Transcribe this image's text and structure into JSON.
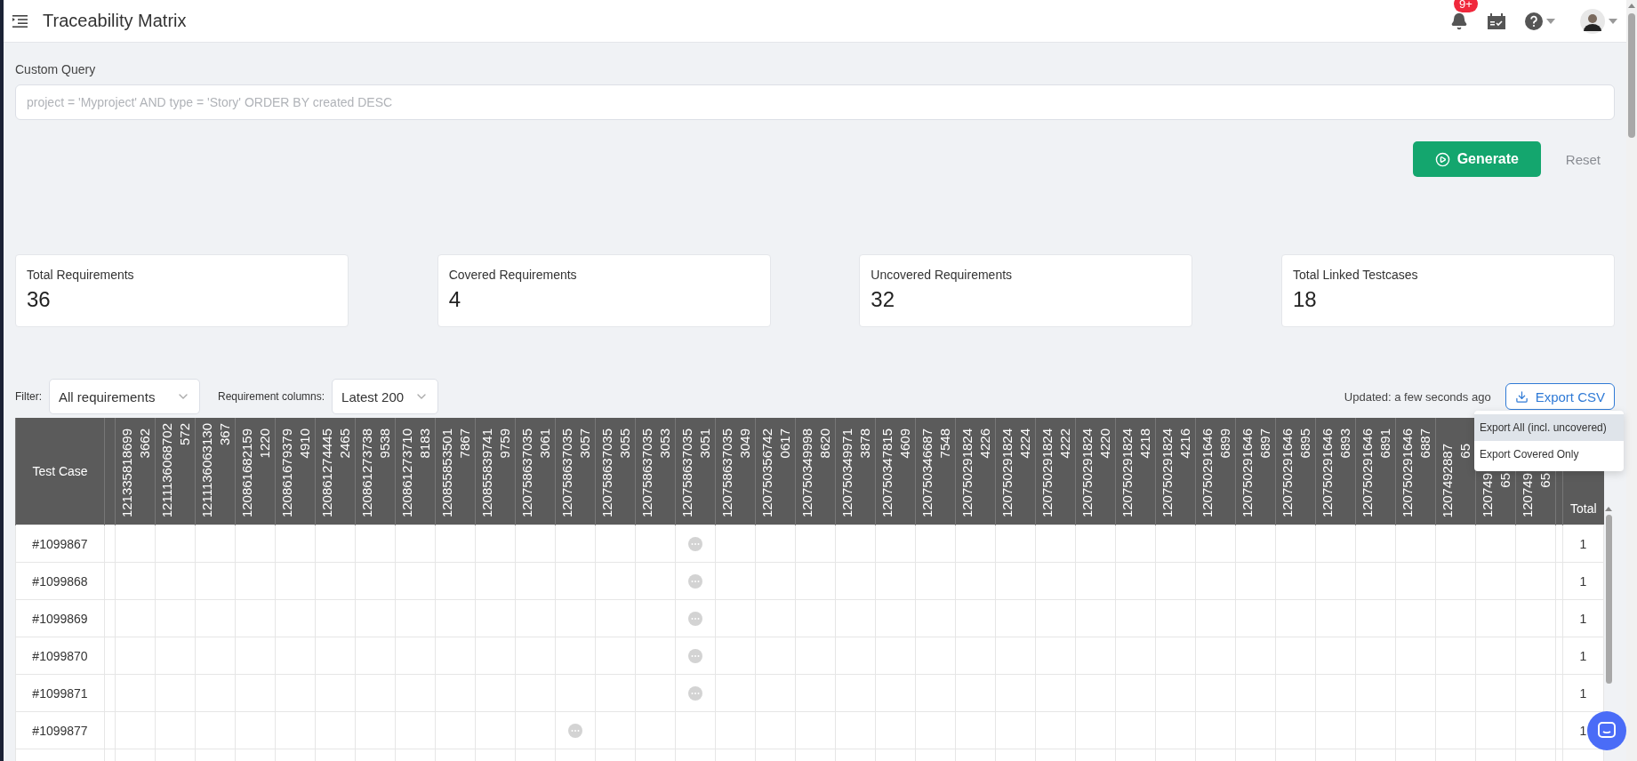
{
  "header": {
    "title": "Traceability Matrix",
    "notification_badge": "9+"
  },
  "query": {
    "label": "Custom Query",
    "placeholder": "project = 'Myproject' AND type = 'Story' ORDER BY created DESC"
  },
  "actions": {
    "generate": "Generate",
    "reset": "Reset"
  },
  "stats": [
    {
      "label": "Total Requirements",
      "value": "36"
    },
    {
      "label": "Covered Requirements",
      "value": "4"
    },
    {
      "label": "Uncovered Requirements",
      "value": "32"
    },
    {
      "label": "Total Linked Testcases",
      "value": "18"
    }
  ],
  "filters": [
    {
      "label": "Filter:",
      "value": "All requirements"
    },
    {
      "label": "Requirement columns:",
      "value": "Latest 200"
    }
  ],
  "updated": "Updated: a few seconds ago",
  "export": {
    "label": "Export CSV",
    "menu": [
      {
        "label": "Export All (incl. uncovered)",
        "highlighted": true
      },
      {
        "label": "Export Covered Only",
        "highlighted": false
      }
    ]
  },
  "table": {
    "first_column": "Test Case",
    "last_column": "Total",
    "columns": [
      [
        "121335818699",
        "3662"
      ],
      [
        "1211136068702",
        "572"
      ],
      [
        "1211136063130",
        "367"
      ],
      [
        "120861682159",
        "1220"
      ],
      [
        "120861679379",
        "4910"
      ],
      [
        "120861274445",
        "2465"
      ],
      [
        "120861273738",
        "9538"
      ],
      [
        "120861273710",
        "8183"
      ],
      [
        "120855853501",
        "7867"
      ],
      [
        "120855839741",
        "9759"
      ],
      [
        "120758637035",
        "3061"
      ],
      [
        "120758637035",
        "3057"
      ],
      [
        "120758637035",
        "3055"
      ],
      [
        "120758637035",
        "3053"
      ],
      [
        "120758637035",
        "3051"
      ],
      [
        "120758637035",
        "3049"
      ],
      [
        "120750356742",
        "0617"
      ],
      [
        "120750349998",
        "8620"
      ],
      [
        "120750349971",
        "3878"
      ],
      [
        "120750347815",
        "4609"
      ],
      [
        "120750346687",
        "7548"
      ],
      [
        "120750291824",
        "4226"
      ],
      [
        "120750291824",
        "4224"
      ],
      [
        "120750291824",
        "4222"
      ],
      [
        "120750291824",
        "4220"
      ],
      [
        "120750291824",
        "4218"
      ],
      [
        "120750291824",
        "4216"
      ],
      [
        "120750291646",
        "6899"
      ],
      [
        "120750291646",
        "6897"
      ],
      [
        "120750291646",
        "6895"
      ],
      [
        "120750291646",
        "6893"
      ],
      [
        "120750291646",
        "6891"
      ],
      [
        "120750291646",
        "6887"
      ],
      [
        "1207492887",
        "65"
      ],
      [
        "120749",
        "65"
      ],
      [
        "120749",
        "65"
      ]
    ],
    "rows": [
      {
        "test_case": "#1099867",
        "total": "1",
        "links": [
          false,
          false,
          false,
          false,
          false,
          false,
          false,
          false,
          false,
          false,
          false,
          false,
          false,
          false,
          true,
          false,
          false,
          false,
          false,
          false,
          false,
          false,
          false,
          false,
          false,
          false,
          false,
          false,
          false,
          false,
          false,
          false,
          false,
          false,
          false,
          false
        ]
      },
      {
        "test_case": "#1099868",
        "total": "1",
        "links": [
          false,
          false,
          false,
          false,
          false,
          false,
          false,
          false,
          false,
          false,
          false,
          false,
          false,
          false,
          true,
          false,
          false,
          false,
          false,
          false,
          false,
          false,
          false,
          false,
          false,
          false,
          false,
          false,
          false,
          false,
          false,
          false,
          false,
          false,
          false,
          false
        ]
      },
      {
        "test_case": "#1099869",
        "total": "1",
        "links": [
          false,
          false,
          false,
          false,
          false,
          false,
          false,
          false,
          false,
          false,
          false,
          false,
          false,
          false,
          true,
          false,
          false,
          false,
          false,
          false,
          false,
          false,
          false,
          false,
          false,
          false,
          false,
          false,
          false,
          false,
          false,
          false,
          false,
          false,
          false,
          false
        ]
      },
      {
        "test_case": "#1099870",
        "total": "1",
        "links": [
          false,
          false,
          false,
          false,
          false,
          false,
          false,
          false,
          false,
          false,
          false,
          false,
          false,
          false,
          true,
          false,
          false,
          false,
          false,
          false,
          false,
          false,
          false,
          false,
          false,
          false,
          false,
          false,
          false,
          false,
          false,
          false,
          false,
          false,
          false,
          false
        ]
      },
      {
        "test_case": "#1099871",
        "total": "1",
        "links": [
          false,
          false,
          false,
          false,
          false,
          false,
          false,
          false,
          false,
          false,
          false,
          false,
          false,
          false,
          true,
          false,
          false,
          false,
          false,
          false,
          false,
          false,
          false,
          false,
          false,
          false,
          false,
          false,
          false,
          false,
          false,
          false,
          false,
          false,
          false,
          false
        ]
      },
      {
        "test_case": "#1099877",
        "total": "1",
        "links": [
          false,
          false,
          false,
          false,
          false,
          false,
          false,
          false,
          false,
          false,
          false,
          true,
          false,
          false,
          false,
          false,
          false,
          false,
          false,
          false,
          false,
          false,
          false,
          false,
          false,
          false,
          false,
          false,
          false,
          false,
          false,
          false,
          false,
          false,
          false,
          false
        ]
      }
    ]
  }
}
